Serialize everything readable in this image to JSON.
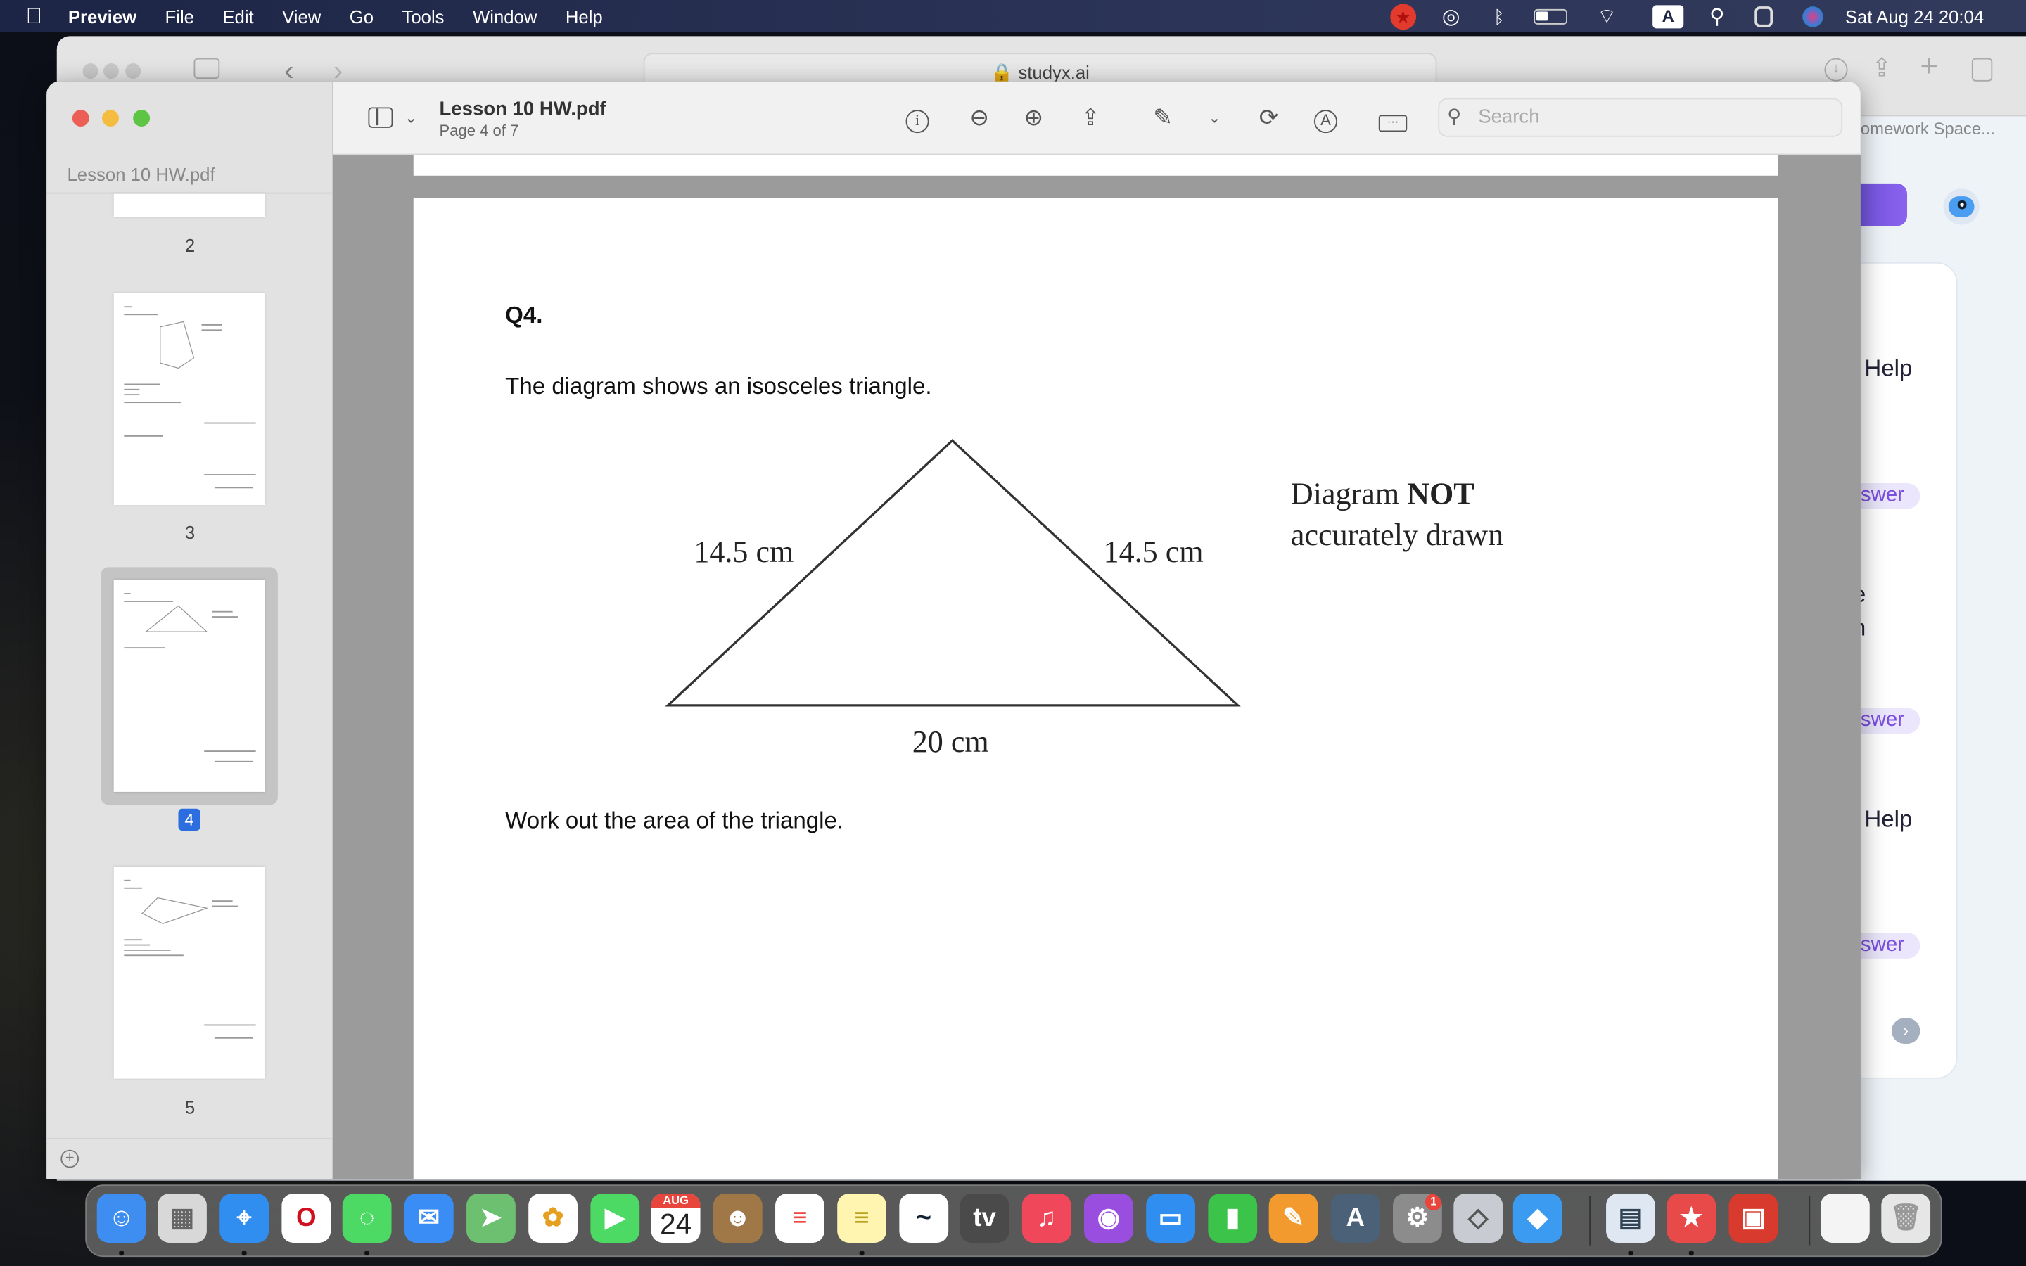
{
  "menubar": {
    "app": "Preview",
    "items": [
      "File",
      "Edit",
      "View",
      "Go",
      "Tools",
      "Window",
      "Help"
    ],
    "input_source": "A",
    "datetime": "Sat Aug 24  20:04"
  },
  "safari": {
    "url": "studyx.ai",
    "tab_title": "omework Space...",
    "panel_texts": {
      "help_1": "y Help",
      "answer_1": "swer",
      "frag_e": "e",
      "frag_n": "n",
      "answer_2": "swer",
      "help_2": "y Help",
      "answer_3": "swer"
    },
    "accent": "#7b5ce6"
  },
  "preview": {
    "title": "Lesson 10 HW.pdf",
    "subtitle": "Page 4 of 7",
    "sidebar_title": "Lesson 10 HW.pdf",
    "search_placeholder": "Search",
    "thumbnails": [
      {
        "page": "2"
      },
      {
        "page": "3"
      },
      {
        "page": "4",
        "selected": true
      },
      {
        "page": "5"
      }
    ]
  },
  "document": {
    "question": "Q4.",
    "intro": "The diagram shows an isosceles triangle.",
    "side_left": "14.5 cm",
    "side_right": "14.5 cm",
    "base": "20 cm",
    "note_regular": "Diagram ",
    "note_bold": "NOT",
    "note_line2": "accurately drawn",
    "task": "Work out the area of the triangle."
  },
  "dock": {
    "calendar_month": "AUG",
    "calendar_day": "24",
    "settings_badge": "1",
    "apps": [
      {
        "name": "finder",
        "color": "#3d8ef0"
      },
      {
        "name": "launchpad",
        "color": "#d8d8d8"
      },
      {
        "name": "safari",
        "color": "#2f8ef0"
      },
      {
        "name": "opera",
        "color": "#ffffff"
      },
      {
        "name": "messages",
        "color": "#4cd964"
      },
      {
        "name": "mail",
        "color": "#3a8df5"
      },
      {
        "name": "maps",
        "color": "#6cc070"
      },
      {
        "name": "photos",
        "color": "#ffffff"
      },
      {
        "name": "facetime",
        "color": "#4cd964"
      },
      {
        "name": "calendar",
        "color": "#ffffff"
      },
      {
        "name": "contacts",
        "color": "#a07848"
      },
      {
        "name": "reminders",
        "color": "#ffffff"
      },
      {
        "name": "notes",
        "color": "#fff4b0"
      },
      {
        "name": "freeform",
        "color": "#ffffff"
      },
      {
        "name": "apple-tv",
        "color": "#4a4a4a"
      },
      {
        "name": "music",
        "color": "#f0485a"
      },
      {
        "name": "podcasts",
        "color": "#9a4ee0"
      },
      {
        "name": "keynote",
        "color": "#2f8ef0"
      },
      {
        "name": "numbers",
        "color": "#3cc34a"
      },
      {
        "name": "pages",
        "color": "#f29a2e"
      },
      {
        "name": "app-store",
        "color": "#4a6178"
      },
      {
        "name": "system-settings",
        "color": "#8c8c8c"
      },
      {
        "name": "roblox",
        "color": "#c8ccd2"
      },
      {
        "name": "roblox-studio",
        "color": "#3a9bf0"
      },
      {
        "name": "preview",
        "color": "#dfe8f2"
      },
      {
        "name": "star-app",
        "color": "#e84a4a"
      },
      {
        "name": "photo-booth",
        "color": "#d93a2e"
      },
      {
        "name": "documents",
        "color": "#f4f4f4"
      },
      {
        "name": "trash",
        "color": "#e6e6e6"
      }
    ]
  }
}
